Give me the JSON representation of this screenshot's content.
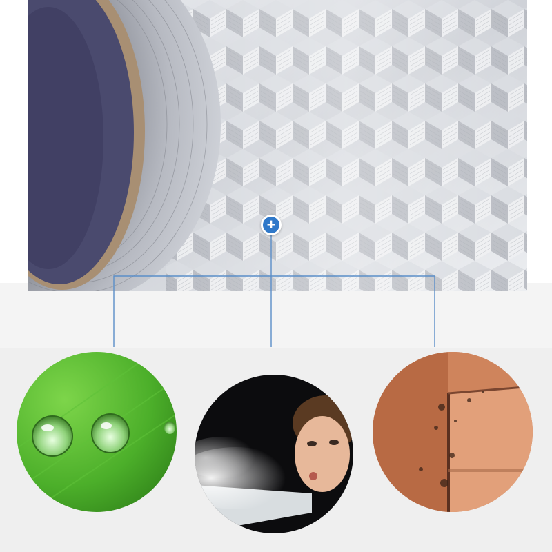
{
  "image": {
    "subject": "foil-tape-product-feature-graphic",
    "hotspot_icon": "plus-icon",
    "hotspot_symbol": "+",
    "features": [
      {
        "id": "waterproof",
        "icon": "water-droplet-on-leaf-photo"
      },
      {
        "id": "dustproof",
        "icon": "person-blowing-dust-photo"
      },
      {
        "id": "mildew-proof",
        "icon": "moldy-wall-corner-photo"
      }
    ]
  },
  "colors": {
    "accent": "#2f78c9",
    "connector": "#5a8ec8",
    "foil": "#c9ccd3",
    "leaf": "#4caf2a",
    "wall": "#c87a52"
  }
}
